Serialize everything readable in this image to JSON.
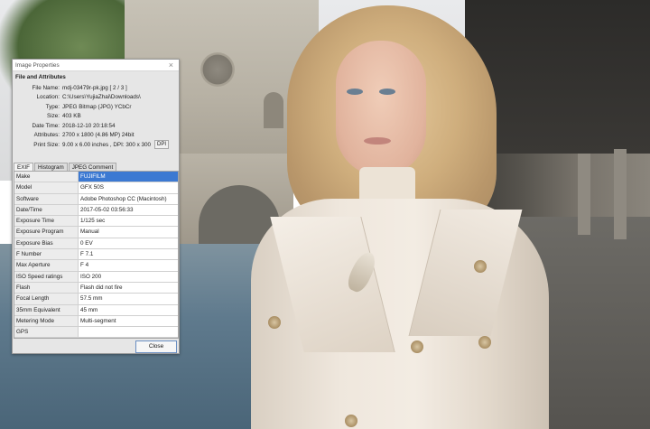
{
  "dialog": {
    "title": "Image Properties",
    "group_header": "File and Attributes",
    "info": [
      {
        "label": "File Name:",
        "value": "mdj-03479r-pk.jpg   [ 2 / 3 ]"
      },
      {
        "label": "Location:",
        "value": "C:\\Users\\YujiaZhai\\Downloads\\"
      },
      {
        "label": "Type:",
        "value": "JPEG Bitmap (JPG) YCbCr"
      },
      {
        "label": "Size:",
        "value": "403 KB"
      },
      {
        "label": "Date Time:",
        "value": "2018-12-10 20:18:54"
      },
      {
        "label": "Attributes:",
        "value": "2700 x 1800 (4.86 MP)  24bit"
      },
      {
        "label": "Print Size:",
        "value": "9.00 x 6.00 inches ,  DPI: 300 x 300"
      }
    ],
    "dpi_button": "DPI",
    "tabs": [
      "EXIF",
      "Histogram",
      "JPEG Comment"
    ],
    "exif_rows": [
      {
        "label": "Make",
        "value": "FUJIFILM"
      },
      {
        "label": "Model",
        "value": "GFX 50S"
      },
      {
        "label": "Software",
        "value": "Adobe Photoshop CC (Macintosh)"
      },
      {
        "label": "Date/Time",
        "value": "2017-05-02 03:56:33"
      },
      {
        "label": "Exposure Time",
        "value": "1/125 sec"
      },
      {
        "label": "Exposure Program",
        "value": "Manual"
      },
      {
        "label": "Exposure Bias",
        "value": "0 EV"
      },
      {
        "label": "F Number",
        "value": "F 7.1"
      },
      {
        "label": "Max Aperture",
        "value": "F 4"
      },
      {
        "label": "ISO Speed ratings",
        "value": "ISO 200"
      },
      {
        "label": "Flash",
        "value": "Flash did not fire"
      },
      {
        "label": "Focal Length",
        "value": "57.5 mm"
      },
      {
        "label": "35mm Equivalent",
        "value": "45 mm"
      },
      {
        "label": "Metering Mode",
        "value": "Multi-segment"
      },
      {
        "label": "GPS",
        "value": ""
      }
    ],
    "close_label": "Close"
  }
}
